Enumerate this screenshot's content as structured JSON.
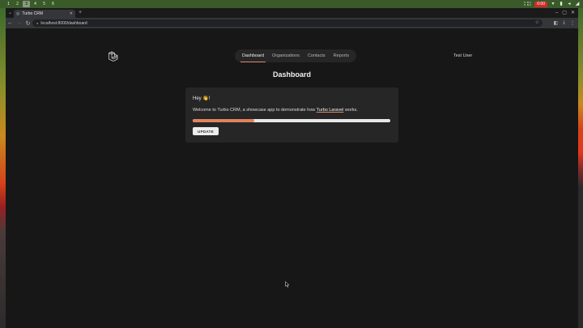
{
  "system_bar": {
    "workspaces": [
      "1",
      "2",
      "3",
      "4",
      "5",
      "6"
    ],
    "active_workspace": "3",
    "net_up": "0 B/s",
    "net_down": "0 B/s",
    "record_label": "0:00"
  },
  "browser": {
    "tab": {
      "title": "Turbo CRM"
    },
    "address": {
      "url": "localhost:8000/dashboard"
    }
  },
  "app": {
    "nav": [
      {
        "label": "Dashboard",
        "active": true
      },
      {
        "label": "Organizations",
        "active": false
      },
      {
        "label": "Contacts",
        "active": false
      },
      {
        "label": "Reports",
        "active": false
      }
    ],
    "user_name": "Test User",
    "page_title": "Dashboard",
    "card": {
      "greeting": "Hey 👋!",
      "welcome_before": "Welcome to Turbo CRM, a showcase app to demonstrate how ",
      "welcome_link": "Turbo Laravel",
      "welcome_after": " works.",
      "progress_fraction": 0.31,
      "button_label": "UPDATE"
    }
  },
  "colors": {
    "accent": "#e0835e",
    "page_bg": "#171717",
    "card_bg": "#262626"
  }
}
